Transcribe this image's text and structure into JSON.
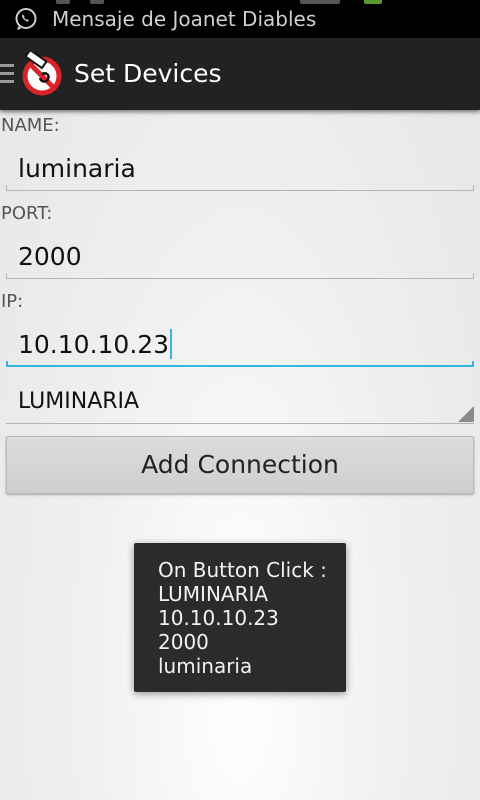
{
  "status_bar": {
    "notification_icon": "whatsapp-icon",
    "notification_text": "Mensaje de Joanet Diables"
  },
  "action_bar": {
    "drawer_icon": "drawer-menu-icon",
    "logo_icon": "app-logo-icon",
    "title": "Set Devices"
  },
  "form": {
    "name_label": "NAME:",
    "name_value": "luminaria",
    "port_label": "PORT:",
    "port_value": "2000",
    "ip_label": "IP:",
    "ip_value": "10.10.10.23",
    "type_value": "LUMINARIA",
    "add_button_label": "Add Connection"
  },
  "toast": {
    "lines": [
      "On Button Click :",
      "LUMINARIA",
      "10.10.10.23",
      "2000",
      "luminaria"
    ]
  },
  "colors": {
    "accent": "#33b5e5",
    "action_bar": "#222222",
    "logo_red": "#d8232a"
  }
}
